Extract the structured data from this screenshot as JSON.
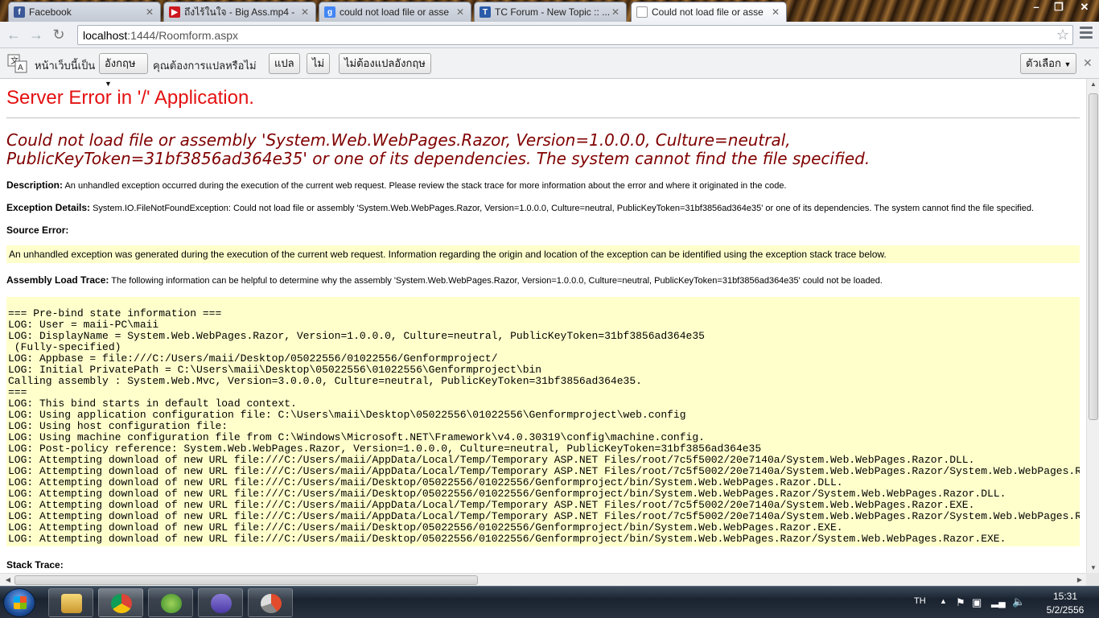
{
  "tabs": [
    {
      "label": "Facebook",
      "icon": "facebook-icon",
      "color": "#3b5998"
    },
    {
      "label": "ถึงไร้ในใจ - Big Ass.mp4 -",
      "icon": "youtube-icon",
      "color": "#cc181e"
    },
    {
      "label": "could not load file or asse",
      "icon": "google-icon",
      "color": "#4285f4"
    },
    {
      "label": "TC Forum - New Topic :: ...",
      "icon": "forum-icon",
      "color": "#2a5aa8"
    },
    {
      "label": "Could not load file or asse",
      "icon": "page-icon",
      "color": "#ffffff"
    }
  ],
  "window": {
    "minimize": "–",
    "restore": "❐",
    "close": "✕"
  },
  "toolbar": {
    "url_host": "localhost",
    "url_rest": ":1444/Roomform.aspx"
  },
  "translate": {
    "label": "หน้าเว็บนี้เป็น",
    "language": "อังกฤษ",
    "question": "คุณต้องการแปลหรือไม่",
    "translate_btn": "แปล",
    "no_btn": "ไม่",
    "never_btn": "ไม่ต้องแปลอังกฤษ",
    "options_btn": "ตัวเลือก"
  },
  "page": {
    "title": "Server Error in '/' Application.",
    "error_heading": "Could not load file or assembly 'System.Web.WebPages.Razor, Version=1.0.0.0, Culture=neutral, PublicKeyToken=31bf3856ad364e35' or one of its dependencies. The system cannot find the file specified.",
    "description_label": "Description:",
    "description_text": "An unhandled exception occurred during the execution of the current web request. Please review the stack trace for more information about the error and where it originated in the code.",
    "exception_label": "Exception Details:",
    "exception_text": "System.IO.FileNotFoundException: Could not load file or assembly 'System.Web.WebPages.Razor, Version=1.0.0.0, Culture=neutral, PublicKeyToken=31bf3856ad364e35' or one of its dependencies. The system cannot find the file specified.",
    "source_label": "Source Error:",
    "source_text": "An unhandled exception was generated during the execution of the current web request. Information regarding the origin and location of the exception can be identified using the exception stack trace below.",
    "assembly_label": "Assembly Load Trace:",
    "assembly_text": "The following information can be helpful to determine why the assembly 'System.Web.WebPages.Razor, Version=1.0.0.0, Culture=neutral, PublicKeyToken=31bf3856ad364e35' could not be loaded.",
    "trace_lines": [
      "=== Pre-bind state information ===",
      "LOG: User = maii-PC\\maii",
      "LOG: DisplayName = System.Web.WebPages.Razor, Version=1.0.0.0, Culture=neutral, PublicKeyToken=31bf3856ad364e35",
      " (Fully-specified)",
      "LOG: Appbase = file:///C:/Users/maii/Desktop/05022556/01022556/Genformproject/",
      "LOG: Initial PrivatePath = C:\\Users\\maii\\Desktop\\05022556\\01022556\\Genformproject\\bin",
      "Calling assembly : System.Web.Mvc, Version=3.0.0.0, Culture=neutral, PublicKeyToken=31bf3856ad364e35.",
      "===",
      "LOG: This bind starts in default load context.",
      "LOG: Using application configuration file: C:\\Users\\maii\\Desktop\\05022556\\01022556\\Genformproject\\web.config",
      "LOG: Using host configuration file:",
      "LOG: Using machine configuration file from C:\\Windows\\Microsoft.NET\\Framework\\v4.0.30319\\config\\machine.config.",
      "LOG: Post-policy reference: System.Web.WebPages.Razor, Version=1.0.0.0, Culture=neutral, PublicKeyToken=31bf3856ad364e35",
      "LOG: Attempting download of new URL file:///C:/Users/maii/AppData/Local/Temp/Temporary ASP.NET Files/root/7c5f5002/20e7140a/System.Web.WebPages.Razor.DLL.",
      "LOG: Attempting download of new URL file:///C:/Users/maii/AppData/Local/Temp/Temporary ASP.NET Files/root/7c5f5002/20e7140a/System.Web.WebPages.Razor/System.Web.WebPages.Razor.DLL.",
      "LOG: Attempting download of new URL file:///C:/Users/maii/Desktop/05022556/01022556/Genformproject/bin/System.Web.WebPages.Razor.DLL.",
      "LOG: Attempting download of new URL file:///C:/Users/maii/Desktop/05022556/01022556/Genformproject/bin/System.Web.WebPages.Razor/System.Web.WebPages.Razor.DLL.",
      "LOG: Attempting download of new URL file:///C:/Users/maii/AppData/Local/Temp/Temporary ASP.NET Files/root/7c5f5002/20e7140a/System.Web.WebPages.Razor.EXE.",
      "LOG: Attempting download of new URL file:///C:/Users/maii/AppData/Local/Temp/Temporary ASP.NET Files/root/7c5f5002/20e7140a/System.Web.WebPages.Razor/System.Web.WebPages.Razor.EXE.",
      "LOG: Attempting download of new URL file:///C:/Users/maii/Desktop/05022556/01022556/Genformproject/bin/System.Web.WebPages.Razor.EXE.",
      "LOG: Attempting download of new URL file:///C:/Users/maii/Desktop/05022556/01022556/Genformproject/bin/System.Web.WebPages.Razor/System.Web.WebPages.Razor.EXE."
    ],
    "stack_label": "Stack Trace:"
  },
  "taskbar": {
    "apps": [
      "explorer-icon",
      "chrome-icon",
      "messenger-icon",
      "visual-studio-icon",
      "app-icon"
    ],
    "lang": "TH",
    "time": "15:31",
    "date": "5/2/2556"
  },
  "colors": {
    "title_red": "#e41111",
    "heading_maroon": "#800000",
    "code_bg": "#ffffcc"
  }
}
